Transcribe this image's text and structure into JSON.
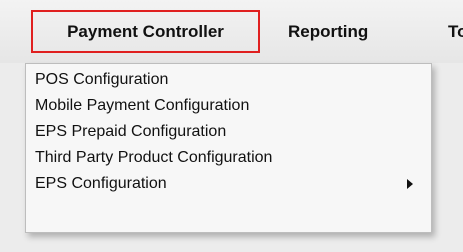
{
  "menubar": {
    "items": [
      {
        "label": "Payment Controller"
      },
      {
        "label": "Reporting"
      },
      {
        "label": "To"
      }
    ]
  },
  "dropdown": {
    "items": [
      {
        "label": "POS Configuration"
      },
      {
        "label": "Mobile Payment Configuration"
      },
      {
        "label": "EPS Prepaid Configuration"
      },
      {
        "label": "Third Party Product Configuration"
      },
      {
        "label": "EPS Configuration",
        "submenu_icon": "triangle-right-icon"
      }
    ]
  },
  "colors": {
    "selected_outline": "#e02020",
    "menubar_background": "#ececec",
    "dropdown_background": "#f7f7f7"
  }
}
